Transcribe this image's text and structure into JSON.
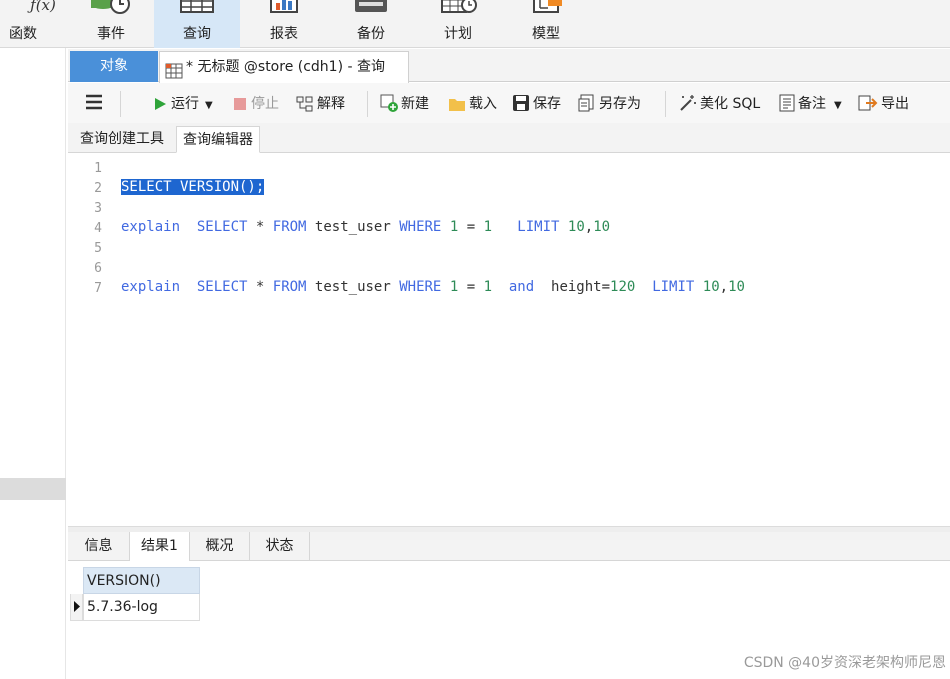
{
  "ribbon": [
    {
      "label": "函数",
      "icon": "function-icon",
      "active": false
    },
    {
      "label": "事件",
      "icon": "event-icon",
      "active": false
    },
    {
      "label": "查询",
      "icon": "query-icon",
      "active": true
    },
    {
      "label": "报表",
      "icon": "report-icon",
      "active": false
    },
    {
      "label": "备份",
      "icon": "backup-icon",
      "active": false
    },
    {
      "label": "计划",
      "icon": "schedule-icon",
      "active": false
    },
    {
      "label": "模型",
      "icon": "model-icon",
      "active": false
    }
  ],
  "tabs": {
    "objects": "对象",
    "query": "* 无标题 @store (cdh1) - 查询"
  },
  "toolbar": {
    "run": "运行",
    "stop": "停止",
    "explain": "解释",
    "new": "新建",
    "load": "载入",
    "save": "保存",
    "save_as": "另存为",
    "beautify": "美化 SQL",
    "notes": "备注",
    "export": "导出"
  },
  "subtabs": {
    "builder": "查询创建工具",
    "editor": "查询编辑器"
  },
  "editor": {
    "line_numbers": [
      "1",
      "2",
      "3",
      "4",
      "5",
      "6",
      "7"
    ],
    "line2": {
      "text": "SELECT VERSION();"
    },
    "line4": {
      "t1": "explain",
      "t2": "SELECT",
      "t3": "*",
      "t4": "FROM",
      "t5": "test_user",
      "t6": "WHERE",
      "t7": "1",
      "t8": "=",
      "t9": "1",
      "t10": "LIMIT",
      "t11": "10",
      "t12": ",",
      "t13": "10"
    },
    "line7": {
      "t1": "explain",
      "t2": "SELECT",
      "t3": "*",
      "t4": "FROM",
      "t5": "test_user",
      "t6": "WHERE",
      "t7": "1",
      "t8": "=",
      "t9": "1",
      "t10": "and",
      "t11": "height=",
      "t12": "120",
      "t13": "LIMIT",
      "t14": "10",
      "t15": ",",
      "t16": "10"
    }
  },
  "result_tabs": [
    "信息",
    "结果1",
    "概况",
    "状态"
  ],
  "grid": {
    "header": "VERSION()",
    "value": "5.7.36-log"
  },
  "watermark": "CSDN @40岁资深老架构师尼恩",
  "colors": {
    "accent": "#4a90d9",
    "keyword": "#4169e1",
    "number": "#2e8b57",
    "selection": "#1e66d0"
  }
}
